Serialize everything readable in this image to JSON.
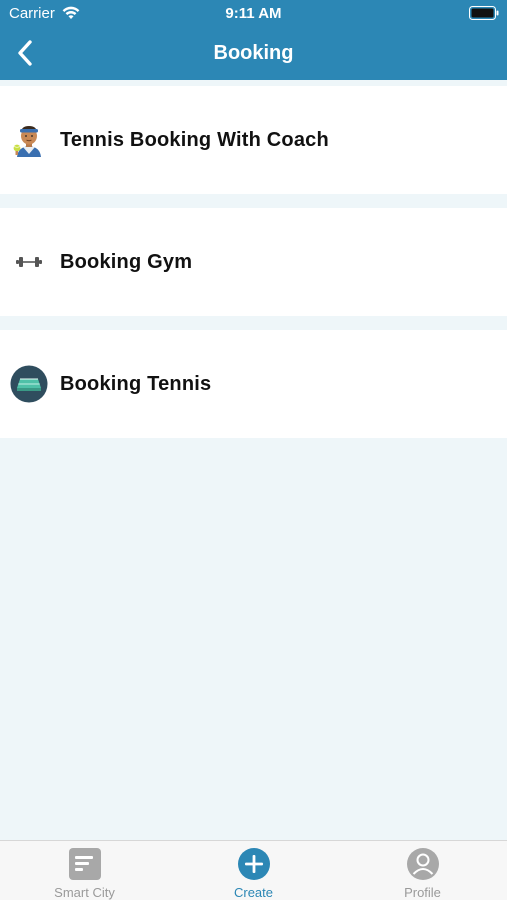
{
  "status_bar": {
    "carrier": "Carrier",
    "time": "9:11 AM",
    "wifi_icon": "wifi-icon",
    "battery_icon": "battery-icon"
  },
  "nav": {
    "title": "Booking",
    "back_icon": "chevron-left-icon"
  },
  "list": {
    "items": [
      {
        "label": "Tennis Booking With Coach",
        "icon": "tennis-coach-icon"
      },
      {
        "label": "Booking Gym",
        "icon": "dumbbell-icon"
      },
      {
        "label": "Booking Tennis",
        "icon": "tennis-court-icon"
      }
    ]
  },
  "tab_bar": {
    "tabs": [
      {
        "label": "Smart City",
        "icon": "document-icon",
        "active": false
      },
      {
        "label": "Create",
        "icon": "plus-circle-icon",
        "active": true
      },
      {
        "label": "Profile",
        "icon": "user-icon",
        "active": false
      }
    ]
  },
  "colors": {
    "header": "#2c87b5",
    "background": "#eef6f9",
    "active_tab": "#2c87b5",
    "inactive_tab": "#9a9a9a"
  }
}
